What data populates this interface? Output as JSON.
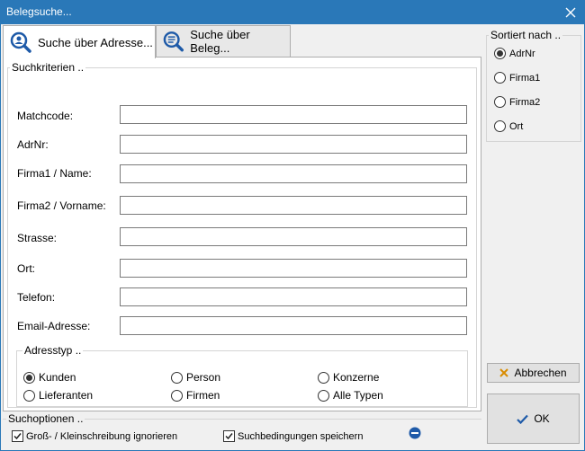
{
  "window": {
    "title": "Belegsuche..."
  },
  "tabs": [
    {
      "label": "Suche über Adresse...",
      "icon": "person-search-icon",
      "active": true
    },
    {
      "label": "Suche über Beleg...",
      "icon": "document-search-icon",
      "active": false
    }
  ],
  "criteria": {
    "legend": "Suchkriterien ..",
    "fields": [
      {
        "label": "Matchcode:",
        "value": ""
      },
      {
        "label": "AdrNr:",
        "value": ""
      },
      {
        "label": "Firma1 / Name:",
        "value": ""
      },
      {
        "label": "Firma2 / Vorname:",
        "value": ""
      },
      {
        "label": "Strasse:",
        "value": ""
      },
      {
        "label": "Ort:",
        "value": ""
      },
      {
        "label": "Telefon:",
        "value": ""
      },
      {
        "label": "Email-Adresse:",
        "value": ""
      }
    ]
  },
  "adresstyp": {
    "legend": "Adresstyp ..",
    "options": [
      {
        "label": "Kunden",
        "selected": true
      },
      {
        "label": "Person",
        "selected": false
      },
      {
        "label": "Konzerne",
        "selected": false
      },
      {
        "label": "Lieferanten",
        "selected": false
      },
      {
        "label": "Firmen",
        "selected": false
      },
      {
        "label": "Alle Typen",
        "selected": false
      }
    ]
  },
  "sort": {
    "legend": "Sortiert nach ..",
    "options": [
      {
        "label": "AdrNr",
        "selected": true
      },
      {
        "label": "Firma1",
        "selected": false
      },
      {
        "label": "Firma2",
        "selected": false
      },
      {
        "label": "Ort",
        "selected": false
      }
    ]
  },
  "searchoptions": {
    "legend": "Suchoptionen ..",
    "case_label": "Groß- / Kleinschreibung ignorieren",
    "case_checked": true,
    "save_label": "Suchbedingungen speichern",
    "save_checked": true
  },
  "buttons": {
    "cancel_label": "Abbrechen",
    "ok_label": "OK"
  },
  "colors": {
    "titlebar": "#2a78b8",
    "accent_blue": "#1e5aa8",
    "cancel_x": "#d98c00"
  }
}
